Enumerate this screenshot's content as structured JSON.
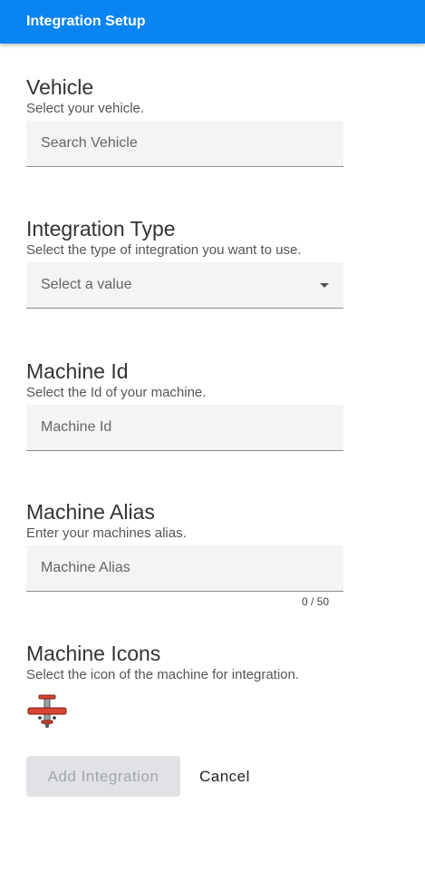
{
  "app_bar": {
    "title": "Integration Setup",
    "color": "#0a84f0"
  },
  "vehicle": {
    "title": "Vehicle",
    "description": "Select your vehicle.",
    "placeholder": "Search Vehicle"
  },
  "integration_type": {
    "title": "Integration Type",
    "description": "Select the type of integration you want to use.",
    "selected": "Select a value"
  },
  "machine_id": {
    "title": "Machine Id",
    "description": "Select the Id of your machine.",
    "placeholder": "Machine Id"
  },
  "machine_alias": {
    "title": "Machine Alias",
    "description": "Enter your machines alias.",
    "placeholder": "Machine Alias",
    "counter": "0 / 50"
  },
  "machine_icons": {
    "title": "Machine Icons",
    "description": "Select the icon of the machine for integration.",
    "icons": [
      "airplane-icon"
    ]
  },
  "actions": {
    "add_label": "Add Integration",
    "cancel_label": "Cancel"
  }
}
